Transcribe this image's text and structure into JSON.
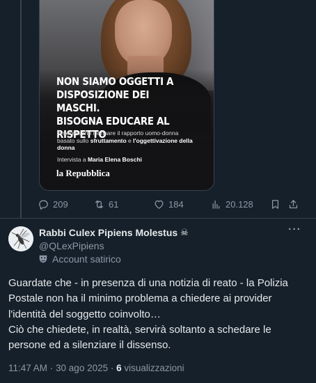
{
  "media": {
    "headline": "NON SIAMO OGGETTI A\nDISPOSIZIONE DEI MASCHI.\nBISOGNA EDUCARE AL RISPETTO",
    "body_prefix": "È necessario incrinare il rapporto uomo-donna basato sullo ",
    "body_bold_1": "sfruttamento",
    "body_middle": " e ",
    "body_bold_2": "l'oggettivazione della donna",
    "interview_prefix": "Intervista a ",
    "interview_name": "Maria Elena Boschi",
    "logo": "la Repubblica"
  },
  "actions": {
    "replies": "209",
    "reposts": "61",
    "likes": "184",
    "views": "20.128"
  },
  "reply": {
    "display_name": "Rabbi Culex Pipiens Molestus",
    "name_emoji": "☠",
    "handle": "@QLexPipiens",
    "more": "···",
    "satire_label": "Account satirico",
    "text_line_1": "Guardate che - in presenza di una notizia di reato - la Polizia Postale non ha il minimo problema a chiedere ai provider l'identità del soggetto coinvolto…",
    "text_line_2": "Ciò che chiedete, in realtà, servirà soltanto a schedare le persone ed a silenziare il dissenso.",
    "time": "11:47 AM · 30 ago 2025 · ",
    "views_count": "6",
    "views_label": " visualizzazioni"
  },
  "icons": {
    "reply": "reply-icon",
    "repost": "repost-icon",
    "like": "heart-icon",
    "views": "analytics-icon",
    "bookmark": "bookmark-icon",
    "share": "share-icon",
    "satire": "theater-mask-icon"
  },
  "colors": {
    "background": "#15202b",
    "border": "#38444d",
    "text": "#e7e9ea",
    "muted": "#8b98a5"
  }
}
